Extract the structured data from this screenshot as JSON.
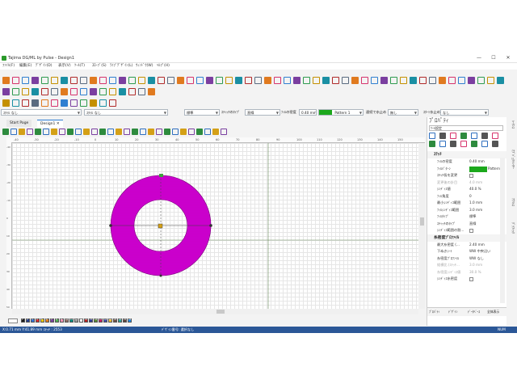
{
  "window": {
    "title": "Tajima DG/ML by Pulse - Design1",
    "minimize": "—",
    "maximize": "☐",
    "close": "✕"
  },
  "menu": [
    "ﾌｧｲﾙ(F)",
    "編集(E)",
    "ﾃﾞｻﾞｲﾝ(D)",
    "表示(V)",
    "ﾂｰﾙ(T)",
    "ｽﾛｰﾌﾞ(S)",
    "ﾗｲﾌﾞﾃﾞｻﾞｲﾝ(L)",
    "ｳｨﾝﾄﾞｳ(W)",
    "ﾍﾙﾌﾟ(H)"
  ],
  "toolbar": {
    "style_combo": "ｽﾀｲﾙ なし",
    "style_combo2": "ｽﾀｲﾙ なし",
    "stitch_type_value": "標準",
    "stitch_type_label": "ｽﾃｨｯﾁのﾀｲﾌﾟ",
    "stitch_type2_value": "直線",
    "fill_spacing_label": "ﾌｨﾙの密度",
    "fill_spacing_value": "0.40 mm",
    "pattern_value": "Pattern 1",
    "continuous_label": "連続で糸止め",
    "continuous_value": "無し",
    "start_stop_label": "ｽﾀｰﾄ糸止め",
    "start_stop_value": "なし"
  },
  "tabs": [
    {
      "label": "Start Page"
    },
    {
      "label": "Design1"
    }
  ],
  "tab_close": "✕",
  "ruler_h": [
    "-40",
    "-30",
    "-20",
    "-10",
    "0",
    "10",
    "20",
    "30",
    "40",
    "50",
    "60",
    "70",
    "80",
    "90",
    "100",
    "110",
    "120",
    "130",
    "140",
    "150"
  ],
  "ruler_v": [
    "-40",
    "-30",
    "-20",
    "-10",
    "0",
    "10",
    "20",
    "30",
    "40",
    "50"
  ],
  "palette_colors": [
    "#1a1a1a",
    "#1f3b8c",
    "#2e6fd6",
    "#d62828",
    "#f0c808",
    "#e37b1a",
    "#7a3e9d",
    "#4caf50",
    "#f48fb1",
    "#8d6e63",
    "#00897b",
    "#9e9e9e",
    "#ffffff",
    "#b71c1c",
    "#283593",
    "#558b2f",
    "#c2185b",
    "#3949ab",
    "#fbc02d",
    "#6d4c41",
    "#26a69a",
    "#5d4037",
    "#1e88e5"
  ],
  "palette_numbers": [
    "1",
    "2",
    "3",
    "4",
    "5",
    "6",
    "7",
    "8",
    "9",
    "10",
    "11",
    "12",
    "13",
    "14",
    "15",
    "16",
    "17",
    "18",
    "19",
    "20",
    "21",
    "22",
    "23"
  ],
  "status": {
    "coords": "X:0.71 mm Y:41.89 mm ｽﾃｯﾁ : 2553",
    "selection": "ﾃﾞｻﾞｲﾝ番号: 選択なし",
    "right": "NUM"
  },
  "panel": {
    "title": "ﾌﾟﾛﾊﾟﾃｨ",
    "subtitle": "ﾂｰﾙ設定",
    "sections": [
      {
        "name": "ｽﾃｯﾁ",
        "rows": [
          {
            "k": "ﾌｨﾙの密度",
            "v": "0.40 mm",
            "dim": false
          },
          {
            "k": "ﾌｨﾙﾊﾟﾀｰﾝ",
            "v": "Pattern...",
            "dim": false
          },
          {
            "k": "ｽﾃｯﾁ長を変更",
            "v": "",
            "dim": false
          },
          {
            "k": "変更後の針目",
            "v": "4.0 mm",
            "dim": true
          },
          {
            "k": "ｼﾝﾃﾞｨｽ値",
            "v": "40.0 %",
            "dim": false
          },
          {
            "k": "ﾌｨﾙ角度",
            "v": "0",
            "dim": false
          },
          {
            "k": "最小ｼﾝﾃﾞｨｽ範囲",
            "v": "1.0 mm",
            "dim": false
          },
          {
            "k": "ﾌｨﾙｼﾝﾃﾞｨｽ範囲",
            "v": "3.0 mm",
            "dim": false
          },
          {
            "k": "ﾌｨﾙﾀｲﾌﾟ",
            "v": "標準",
            "dim": false
          },
          {
            "k": "ｽﾃｨｯﾁのﾀｲﾌﾟ",
            "v": "直線",
            "dim": false
          },
          {
            "k": "ｼﾝﾃﾞｨｽ範囲の割...",
            "v": "",
            "dim": false
          }
        ]
      },
      {
        "name": "糸密度ﾌﾟﾛﾌｧｲﾙ",
        "rows": [
          {
            "k": "最大糸密度 (...",
            "v": "2.40 mm",
            "dim": false
          },
          {
            "k": "下ぬきｼｰﾄ",
            "v": "WW 中央沿い",
            "dim": false
          },
          {
            "k": "糸密度ﾌﾟﾛﾌｧｲﾙ",
            "v": "WW なし",
            "dim": false
          },
          {
            "k": "縦横比 (ｽﾃｯﾁ...",
            "v": "3.0 mm",
            "dim": true
          },
          {
            "k": "糸密度ｼﾝﾃﾞｨｽ値",
            "v": "30.0 %",
            "dim": true
          },
          {
            "k": "ｼﾝﾃﾞｨｽ糸密度",
            "v": "",
            "dim": false
          }
        ]
      }
    ],
    "bottom_tabs": [
      "ﾌﾟﾛﾊﾟﾃｨ",
      "ﾃﾞｻﾞｲﾝ",
      "ﾃﾞｰﾀﾍﾞｰｽ",
      "全体表示"
    ]
  },
  "side_tabs": [
    "ｼｰｹﾝｽ",
    "ｵﾌﾞｼﾞｪｸﾄﾚｲﾔｰ",
    "ｱﾅﾘｼｽ",
    "ｸﾞﾗﾌｨｯｸ"
  ],
  "design": {
    "shape": "ring",
    "fill_color": "#d400d4",
    "stitches": 2553
  }
}
